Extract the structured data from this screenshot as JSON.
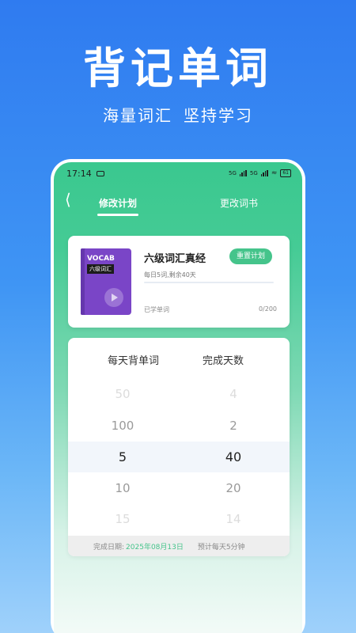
{
  "promo": {
    "title": "背记单词",
    "subtitle_left": "海量词汇",
    "subtitle_right": "坚持学习"
  },
  "status_bar": {
    "time": "17:14",
    "network_a": "5G",
    "network_b": "5G",
    "battery": "61"
  },
  "nav": {
    "back_icon": "chevron-left-icon",
    "tabs": [
      {
        "label": "修改计划",
        "active": true
      },
      {
        "label": "更改词书",
        "active": false
      }
    ]
  },
  "book": {
    "cover_title": "VOCAB",
    "cover_subtitle": "六级词汇",
    "name": "六级词汇真经",
    "reset_label": "重置计划",
    "daily_info": "每日5词,剩余40天",
    "progress": 0,
    "learned_label": "已学单词",
    "learned_count": "0/200"
  },
  "picker": {
    "left_header": "每天背单词",
    "right_header": "完成天数",
    "left_values": [
      "50",
      "100",
      "5",
      "10",
      "15"
    ],
    "right_values": [
      "4",
      "2",
      "40",
      "20",
      "14"
    ],
    "selected_index": 2
  },
  "footer": {
    "date_label": "完成日期:",
    "date_value": "2025年08月13日",
    "estimate": "预计每天5分钟"
  },
  "colors": {
    "accent_green": "#45c48b",
    "promo_blue": "#2f7bf0",
    "cover_purple": "#7a45c7"
  }
}
